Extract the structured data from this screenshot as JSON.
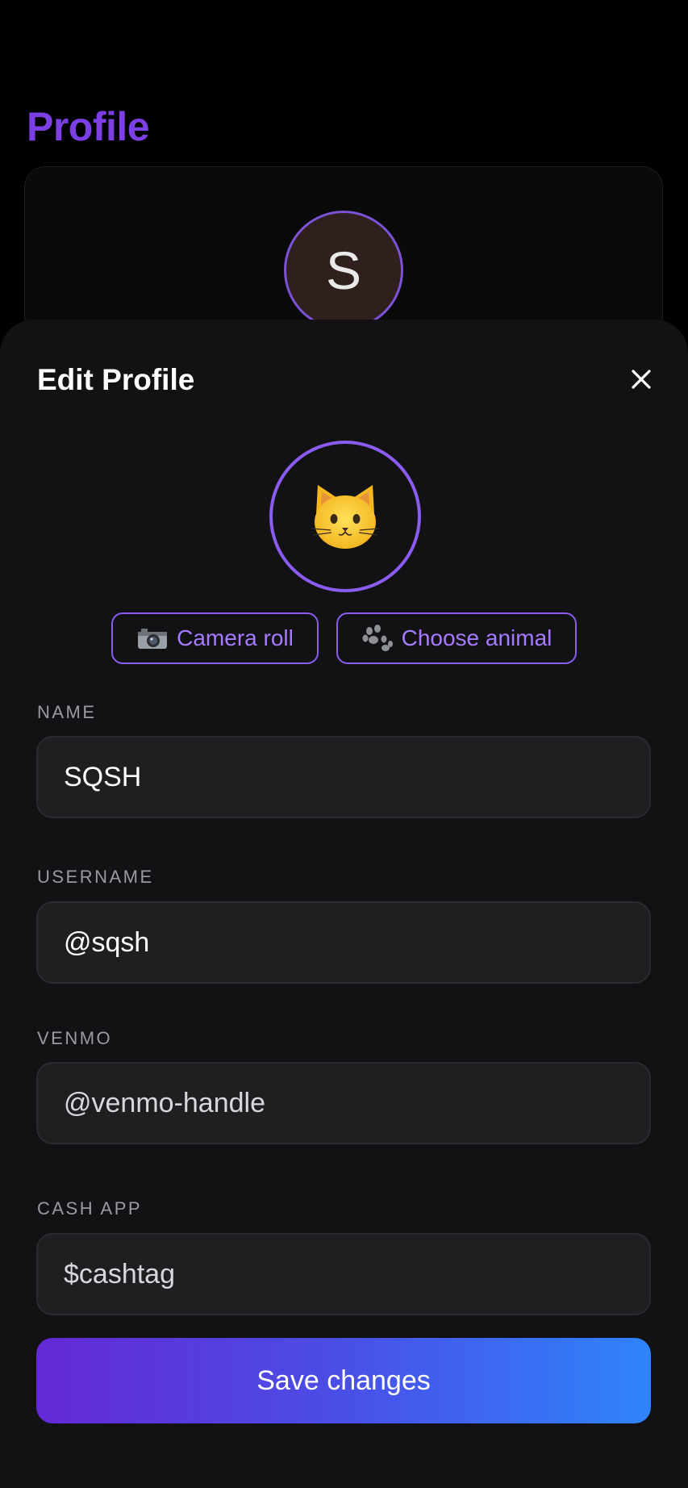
{
  "background": {
    "title": "Profile",
    "avatar_initial": "S"
  },
  "sheet": {
    "title": "Edit Profile",
    "close_icon": "close-icon",
    "avatar_emoji": "cat-face",
    "accent_color": "#8a5cf0",
    "buttons": {
      "camera_roll": {
        "icon": "camera-icon",
        "label": "Camera roll"
      },
      "choose_animal": {
        "icon": "paw-icon",
        "label": "Choose animal"
      }
    },
    "fields": {
      "name": {
        "label": "NAME",
        "value": "SQSH"
      },
      "username": {
        "label": "USERNAME",
        "value": "@sqsh"
      },
      "venmo": {
        "label": "VENMO",
        "placeholder": "@venmo-handle"
      },
      "cashapp": {
        "label": "CASH APP",
        "placeholder": "$cashtag"
      }
    },
    "save_label": "Save changes",
    "gradient_colors": [
      "#6428d6",
      "#2f84fb"
    ]
  }
}
